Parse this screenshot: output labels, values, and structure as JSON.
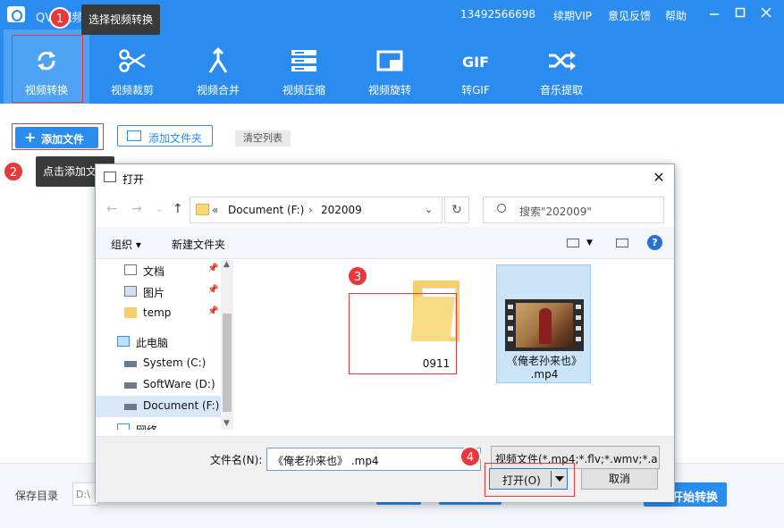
{
  "app": {
    "title": "QVE视频转换器",
    "phone": "13492566698",
    "vip": "续期VIP",
    "feedback": "意见反馈",
    "help": "帮助",
    "window_buttons": [
      "minimize-icon",
      "maximize-icon",
      "close-icon"
    ]
  },
  "toolbar": {
    "tools": [
      {
        "label": "视频转换",
        "icon": "convert-icon"
      },
      {
        "label": "视频裁剪",
        "icon": "scissors-icon"
      },
      {
        "label": "视频合并",
        "icon": "merge-icon"
      },
      {
        "label": "视频压缩",
        "icon": "compress-icon"
      },
      {
        "label": "视频旋转",
        "icon": "rotate-icon"
      },
      {
        "label": "转GIF",
        "icon": "gif-icon"
      },
      {
        "label": "音乐提取",
        "icon": "shuffle-icon"
      }
    ]
  },
  "actions": {
    "add_file": "添加文件",
    "add_folder": "添加文件夹",
    "clear_list": "清空列表"
  },
  "tooltips": {
    "step1": "选择视频转换",
    "step2": "点击添加文件"
  },
  "steps": [
    "1",
    "2",
    "3",
    "4"
  ],
  "bottom": {
    "save_dir_label": "保存目录",
    "save_path": "D:\\",
    "start_button": "开始转换"
  },
  "dialog": {
    "title": "打开",
    "breadcrumb": [
      "«",
      "Document (F:)",
      "›",
      "202009"
    ],
    "search_placeholder": "搜索\"202009\"",
    "organize": "组织 ▾",
    "new_folder": "新建文件夹",
    "nav_items": [
      {
        "label": "文档",
        "pinned": true
      },
      {
        "label": "图片",
        "pinned": true
      },
      {
        "label": "temp",
        "pinned": true
      },
      {
        "label": "此电脑",
        "pinned": false
      },
      {
        "label": "System (C:)",
        "pinned": false
      },
      {
        "label": "SoftWare (D:)",
        "pinned": false
      },
      {
        "label": "Document (F:)",
        "pinned": false
      },
      {
        "label": "网络",
        "pinned": false
      }
    ],
    "files": [
      {
        "name": "0911",
        "type": "folder"
      },
      {
        "name_line1": "《俺老孙来也》",
        "name_line2": ".mp4",
        "type": "video"
      }
    ],
    "filename_label": "文件名(N):",
    "filename_value": "《俺老孙来也》 .mp4",
    "filetype_value": "视频文件(*.mp4;*.flv;*.wmv;*.a",
    "open_button": "打开(O)",
    "cancel_button": "取消"
  },
  "colors": {
    "brand_blue": "#2b8cf0",
    "highlight_red": "#e63a3a",
    "step_red": "#e8383b"
  }
}
